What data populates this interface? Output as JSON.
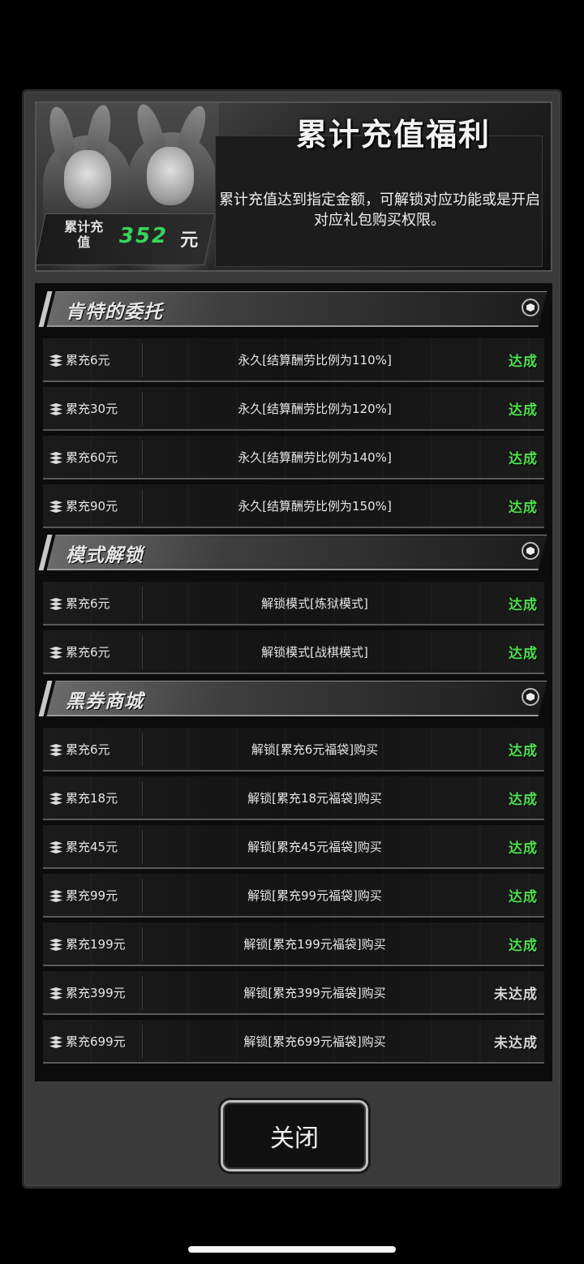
{
  "header": {
    "title": "累计充值福利",
    "description": "累计充值达到指定金额，可解锁对应功能或是开启对应礼包购买权限。",
    "counter": {
      "label": "累计充值",
      "value": "352",
      "unit": "元"
    }
  },
  "sections": [
    {
      "title": "肯特的委托",
      "rows": [
        {
          "requirement": "累充6元",
          "reward": "永久[结算酬劳比例为110%]",
          "status": "达成",
          "achieved": true
        },
        {
          "requirement": "累充30元",
          "reward": "永久[结算酬劳比例为120%]",
          "status": "达成",
          "achieved": true
        },
        {
          "requirement": "累充60元",
          "reward": "永久[结算酬劳比例为140%]",
          "status": "达成",
          "achieved": true
        },
        {
          "requirement": "累充90元",
          "reward": "永久[结算酬劳比例为150%]",
          "status": "达成",
          "achieved": true
        }
      ]
    },
    {
      "title": "模式解锁",
      "rows": [
        {
          "requirement": "累充6元",
          "reward": "解锁模式[炼狱模式]",
          "status": "达成",
          "achieved": true
        },
        {
          "requirement": "累充6元",
          "reward": "解锁模式[战棋模式]",
          "status": "达成",
          "achieved": true
        }
      ]
    },
    {
      "title": "黑券商城",
      "rows": [
        {
          "requirement": "累充6元",
          "reward": "解锁[累充6元福袋]购买",
          "status": "达成",
          "achieved": true
        },
        {
          "requirement": "累充18元",
          "reward": "解锁[累充18元福袋]购买",
          "status": "达成",
          "achieved": true
        },
        {
          "requirement": "累充45元",
          "reward": "解锁[累充45元福袋]购买",
          "status": "达成",
          "achieved": true
        },
        {
          "requirement": "累充99元",
          "reward": "解锁[累充99元福袋]购买",
          "status": "达成",
          "achieved": true
        },
        {
          "requirement": "累充199元",
          "reward": "解锁[累充199元福袋]购买",
          "status": "达成",
          "achieved": true
        },
        {
          "requirement": "累充399元",
          "reward": "解锁[累充399元福袋]购买",
          "status": "未达成",
          "achieved": false
        },
        {
          "requirement": "累充699元",
          "reward": "解锁[累充699元福袋]购买",
          "status": "未达成",
          "achieved": false
        }
      ]
    }
  ],
  "close_button": {
    "label": "关闭"
  },
  "colors": {
    "achieved": "#4ee04e",
    "not_achieved": "#d8d8d8",
    "counter_value": "#37d65a"
  }
}
